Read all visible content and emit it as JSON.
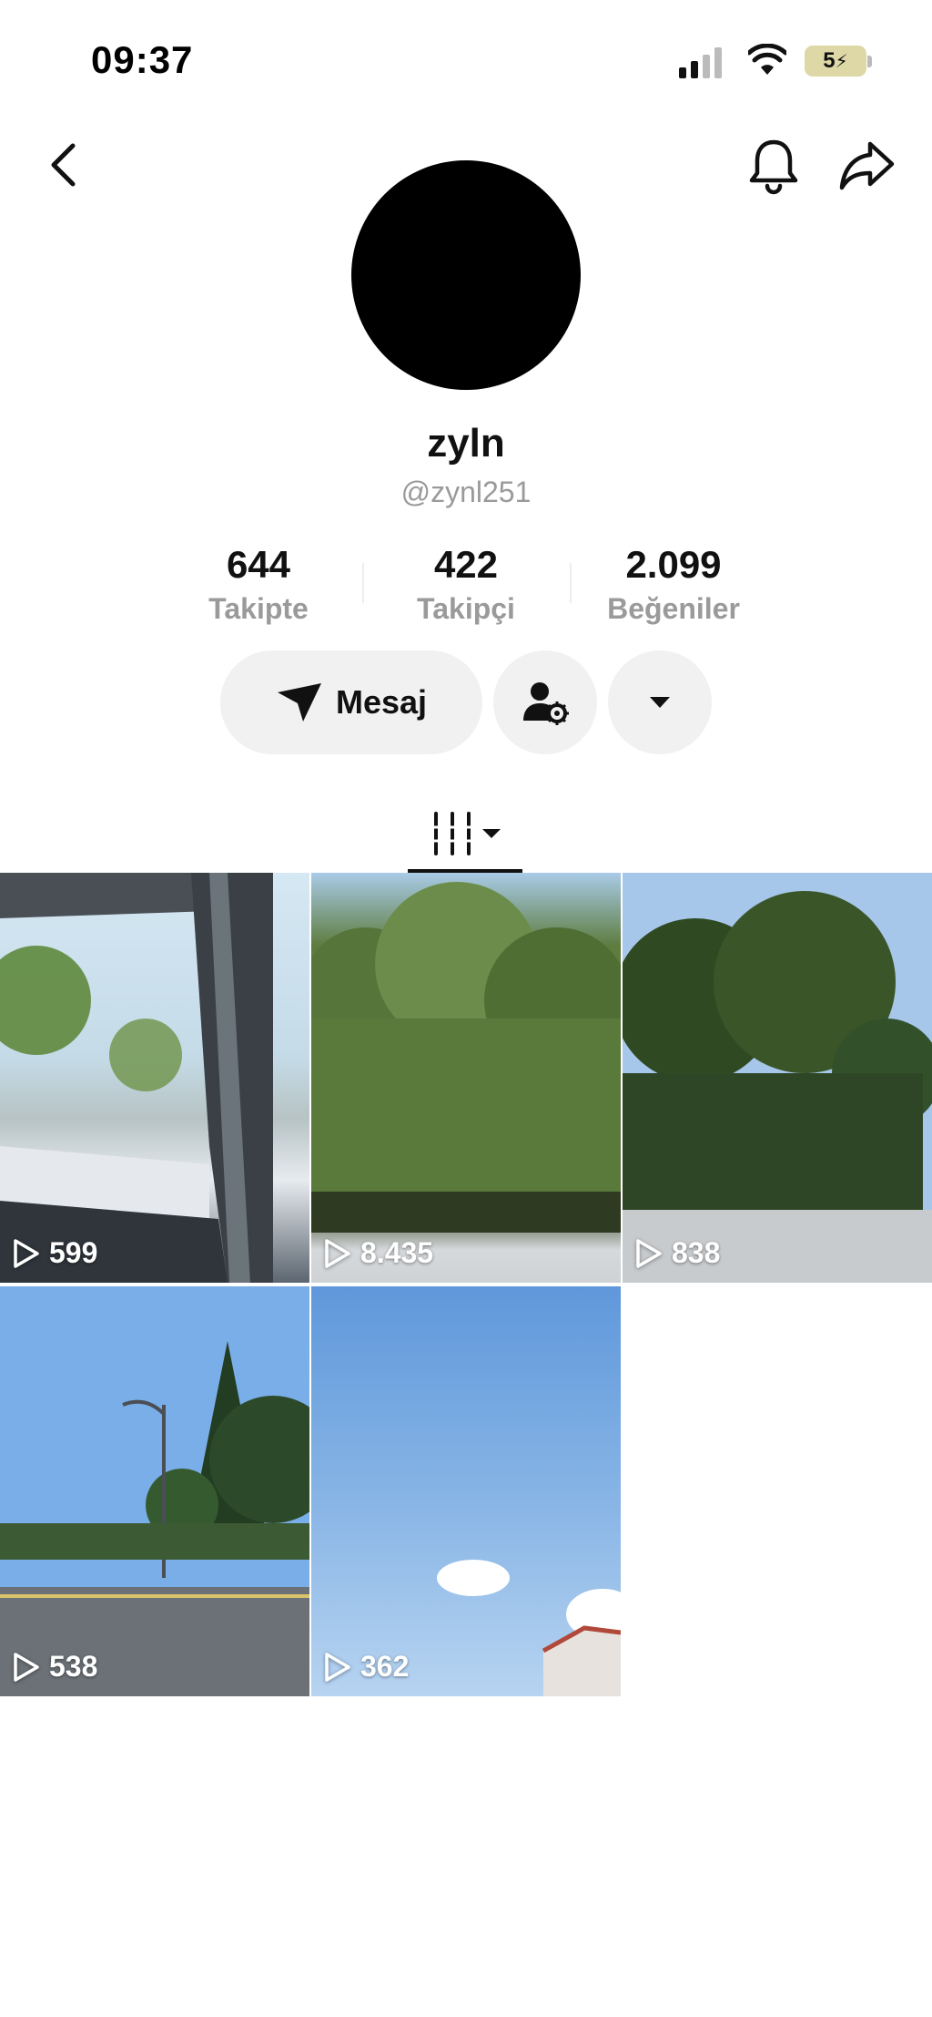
{
  "status_bar": {
    "time": "09:37",
    "battery": "5"
  },
  "profile": {
    "display_name": "zyln",
    "handle": "@zynl251",
    "stats": [
      {
        "value": "644",
        "label": "Takipte"
      },
      {
        "value": "422",
        "label": "Takipçi"
      },
      {
        "value": "2.099",
        "label": "Beğeniler"
      }
    ]
  },
  "actions": {
    "message_label": "Mesaj"
  },
  "videos": [
    {
      "views": "599"
    },
    {
      "views": "8.435"
    },
    {
      "views": "838"
    },
    {
      "views": "538"
    },
    {
      "views": "362"
    }
  ],
  "icons": {
    "back": "chevron-left-icon",
    "bell": "bell-icon",
    "share": "share-arrow-icon",
    "message": "send-icon",
    "add_friend": "person-settings-icon",
    "more": "caret-down-icon",
    "grid": "grid-icon",
    "play": "play-icon"
  }
}
